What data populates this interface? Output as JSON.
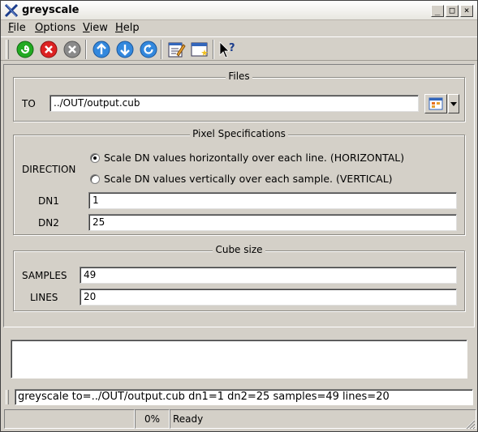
{
  "window": {
    "title": "greyscale",
    "app_icon": "x-logo-icon",
    "controls": [
      "_",
      "□",
      "×"
    ]
  },
  "menu": {
    "items": [
      {
        "label_ul": "F",
        "label_rest": "ile"
      },
      {
        "label_ul": "O",
        "label_rest": "ptions"
      },
      {
        "label_ul": "V",
        "label_rest": "iew"
      },
      {
        "label_ul": "H",
        "label_rest": "elp"
      }
    ]
  },
  "toolbar": {
    "buttons": [
      "run-icon",
      "stop-icon",
      "cancel-icon",
      "up-arrow-icon",
      "down-arrow-icon",
      "refresh-icon",
      "edit-icon",
      "window-icon",
      "whats-this-icon"
    ],
    "colors": {
      "run": "#22aa22",
      "stop": "#dd2222",
      "cancel": "#888888",
      "nav": "#3388dd"
    }
  },
  "files": {
    "title": "Files",
    "to_label": "TO",
    "to_value": "../OUT/output.cub"
  },
  "pixel_spec": {
    "title": "Pixel Specifications",
    "direction_label": "DIRECTION",
    "options": [
      {
        "label": "Scale DN values horizontally over each line. (HORIZONTAL)",
        "checked": true
      },
      {
        "label": "Scale DN values vertically over each sample. (VERTICAL)",
        "checked": false
      }
    ],
    "dn1_label": "DN1",
    "dn1_value": "1",
    "dn2_label": "DN2",
    "dn2_value": "25"
  },
  "cube_size": {
    "title": "Cube size",
    "samples_label": "SAMPLES",
    "samples_value": "49",
    "lines_label": "LINES",
    "lines_value": "20"
  },
  "command_line": "greyscale to=../OUT/output.cub dn1=1 dn2=25 samples=49 lines=20",
  "status": {
    "progress_text": "0%",
    "progress_fraction": 0,
    "message": "Ready"
  }
}
